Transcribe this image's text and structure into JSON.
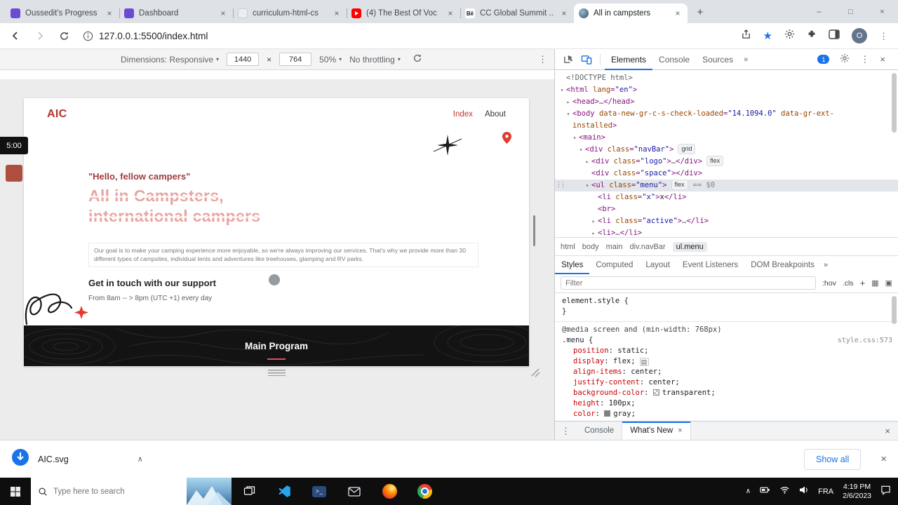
{
  "glyphs": {
    "close": "×",
    "plus": "+",
    "minimize": "–",
    "maximize": "□",
    "kebab": "⋮",
    "more": "»",
    "caret": "▾",
    "tri_right": "▸",
    "tri_down": "▾",
    "chevron_up": "∧",
    "flex_icon": "▤",
    "swatch_a": "▦",
    "swatch_b": "▣",
    "times": "×"
  },
  "tabbar": {
    "tabs": [
      {
        "title": "Oussedit's Progress",
        "fav": "purple"
      },
      {
        "title": "Dashboard",
        "fav": "purple"
      },
      {
        "title": "curriculum-html-cs",
        "fav": "doc"
      },
      {
        "title": "(4) The Best Of Voc",
        "fav": "youtube"
      },
      {
        "title": "CC Global Summit ...",
        "fav": "behance",
        "fav_text": "Bē"
      },
      {
        "title": "All in campsters",
        "fav": "site",
        "active": true
      }
    ],
    "window_controls": {
      "minimize": "–",
      "maximize": "□",
      "close": "×"
    }
  },
  "addressbar": {
    "url": "127.0.0.1:5500/index.html",
    "profile_initial": "O"
  },
  "device_toolbar": {
    "dimensions": "Dimensions: Responsive",
    "width": "1440",
    "times": "×",
    "height": "764",
    "zoom": "50%",
    "throttling": "No throttling"
  },
  "page": {
    "recorder_time": "5:00",
    "logo": "AIC",
    "nav_index": "Index",
    "nav_about": "About",
    "quote": "\"Hello, fellow campers\"",
    "heading_line1": "All in Campsters,",
    "heading_line2": "international campers",
    "paragraph": "Our goal is to make your camping experience more enjoyable, so we're always improving our services. That's why we provide more than 30 different types of campsites, individual tents and adventures like treehouses, glamping and RV parks.",
    "support_title": "Get in touch with our support",
    "support_hours": "From 8am -- > 8pm (UTC +1) every day",
    "banner_title": "Main Program"
  },
  "devtools": {
    "panel_tabs": [
      "Elements",
      "Console",
      "Sources"
    ],
    "issues_count": "1",
    "tree": [
      {
        "ind": 0,
        "arr": "",
        "seg": [
          [
            "g",
            "<!DOCTYPE html>"
          ]
        ]
      },
      {
        "ind": 0,
        "arr": "v",
        "seg": [
          [
            "t",
            "<html "
          ],
          [
            "a",
            "lang"
          ],
          [
            "t",
            "="
          ],
          [
            "v",
            "\"en\""
          ],
          [
            "t",
            ">"
          ]
        ]
      },
      {
        "ind": 1,
        "arr": "r",
        "seg": [
          [
            "t",
            "<head>"
          ],
          [
            "g",
            "…"
          ],
          [
            "t",
            "</head>"
          ]
        ]
      },
      {
        "ind": 1,
        "arr": "v",
        "seg": [
          [
            "t",
            "<body "
          ],
          [
            "a",
            "data-new-gr-c-s-check-loaded"
          ],
          [
            "t",
            "="
          ],
          [
            "v",
            "\"14.1094.0\""
          ],
          [
            "a",
            " data-gr-ext-"
          ]
        ]
      },
      {
        "ind": 1,
        "arr": "",
        "seg": [
          [
            "a",
            "installed"
          ],
          [
            "t",
            ">"
          ]
        ]
      },
      {
        "ind": 2,
        "arr": "v",
        "seg": [
          [
            "t",
            "<main>"
          ]
        ]
      },
      {
        "ind": 3,
        "arr": "v",
        "seg": [
          [
            "t",
            "<div "
          ],
          [
            "a",
            "class"
          ],
          [
            "t",
            "="
          ],
          [
            "v",
            "\"navBar\""
          ],
          [
            "t",
            ">"
          ]
        ],
        "badge": "grid"
      },
      {
        "ind": 4,
        "arr": "r",
        "seg": [
          [
            "t",
            "<div "
          ],
          [
            "a",
            "class"
          ],
          [
            "t",
            "="
          ],
          [
            "v",
            "\"logo\""
          ],
          [
            "t",
            ">"
          ],
          [
            "g",
            "…"
          ],
          [
            "t",
            "</div>"
          ]
        ],
        "badge": "flex"
      },
      {
        "ind": 4,
        "arr": "",
        "seg": [
          [
            "t",
            "<div "
          ],
          [
            "a",
            "class"
          ],
          [
            "t",
            "="
          ],
          [
            "v",
            "\"space\""
          ],
          [
            "t",
            "></div>"
          ]
        ]
      },
      {
        "ind": 4,
        "arr": "v",
        "sel": true,
        "seg": [
          [
            "t",
            "<ul "
          ],
          [
            "a",
            "class"
          ],
          [
            "t",
            "="
          ],
          [
            "v",
            "\"menu\""
          ],
          [
            "t",
            ">"
          ]
        ],
        "badge": "flex",
        "dim": "== $0"
      },
      {
        "ind": 5,
        "arr": "",
        "seg": [
          [
            "t",
            "<li "
          ],
          [
            "a",
            "class"
          ],
          [
            "t",
            "="
          ],
          [
            "v",
            "\"x\""
          ],
          [
            "t",
            ">"
          ],
          [
            "x",
            "x"
          ],
          [
            "t",
            "</li>"
          ]
        ]
      },
      {
        "ind": 5,
        "arr": "",
        "seg": [
          [
            "t",
            "<br>"
          ]
        ]
      },
      {
        "ind": 5,
        "arr": "r",
        "seg": [
          [
            "t",
            "<li "
          ],
          [
            "a",
            "class"
          ],
          [
            "t",
            "="
          ],
          [
            "v",
            "\"active\""
          ],
          [
            "t",
            ">"
          ],
          [
            "g",
            "…"
          ],
          [
            "t",
            "</li>"
          ]
        ]
      },
      {
        "ind": 5,
        "arr": "r",
        "seg": [
          [
            "t",
            "<li>"
          ],
          [
            "g",
            "…"
          ],
          [
            "t",
            "</li>"
          ]
        ]
      }
    ],
    "breadcrumbs": [
      "html",
      "body",
      "main",
      "div.navBar",
      "ul.menu"
    ],
    "sidebar_tabs": [
      "Styles",
      "Computed",
      "Layout",
      "Event Listeners",
      "DOM Breakpoints"
    ],
    "filter_placeholder": "Filter",
    "toggle_hov": ":hov",
    "toggle_cls": ".cls",
    "toggle_add": "+",
    "element_style_open": "element.style {",
    "element_style_close": "}",
    "media_query": "@media screen and (min-width: 768px)",
    "rule_selector": ".menu {",
    "rule_source": "style.css:573",
    "css_props": [
      {
        "name": "position",
        "value": "static"
      },
      {
        "name": "display",
        "value": "flex",
        "flex_icon": true
      },
      {
        "name": "align-items",
        "value": "center"
      },
      {
        "name": "justify-content",
        "value": "center"
      },
      {
        "name": "background-color",
        "value": "transparent",
        "swatch": "transparent"
      },
      {
        "name": "height",
        "value": "100px"
      },
      {
        "name": "color",
        "value": "gray",
        "swatch": "#808080"
      }
    ],
    "drawer": {
      "console": "Console",
      "whats_new": "What's New"
    }
  },
  "download_bar": {
    "filename": "AIC.svg",
    "show_all": "Show all"
  },
  "taskbar": {
    "search_placeholder": "Type here to search",
    "language": "FRA",
    "time": "4:19 PM",
    "date": "2/6/2023"
  }
}
